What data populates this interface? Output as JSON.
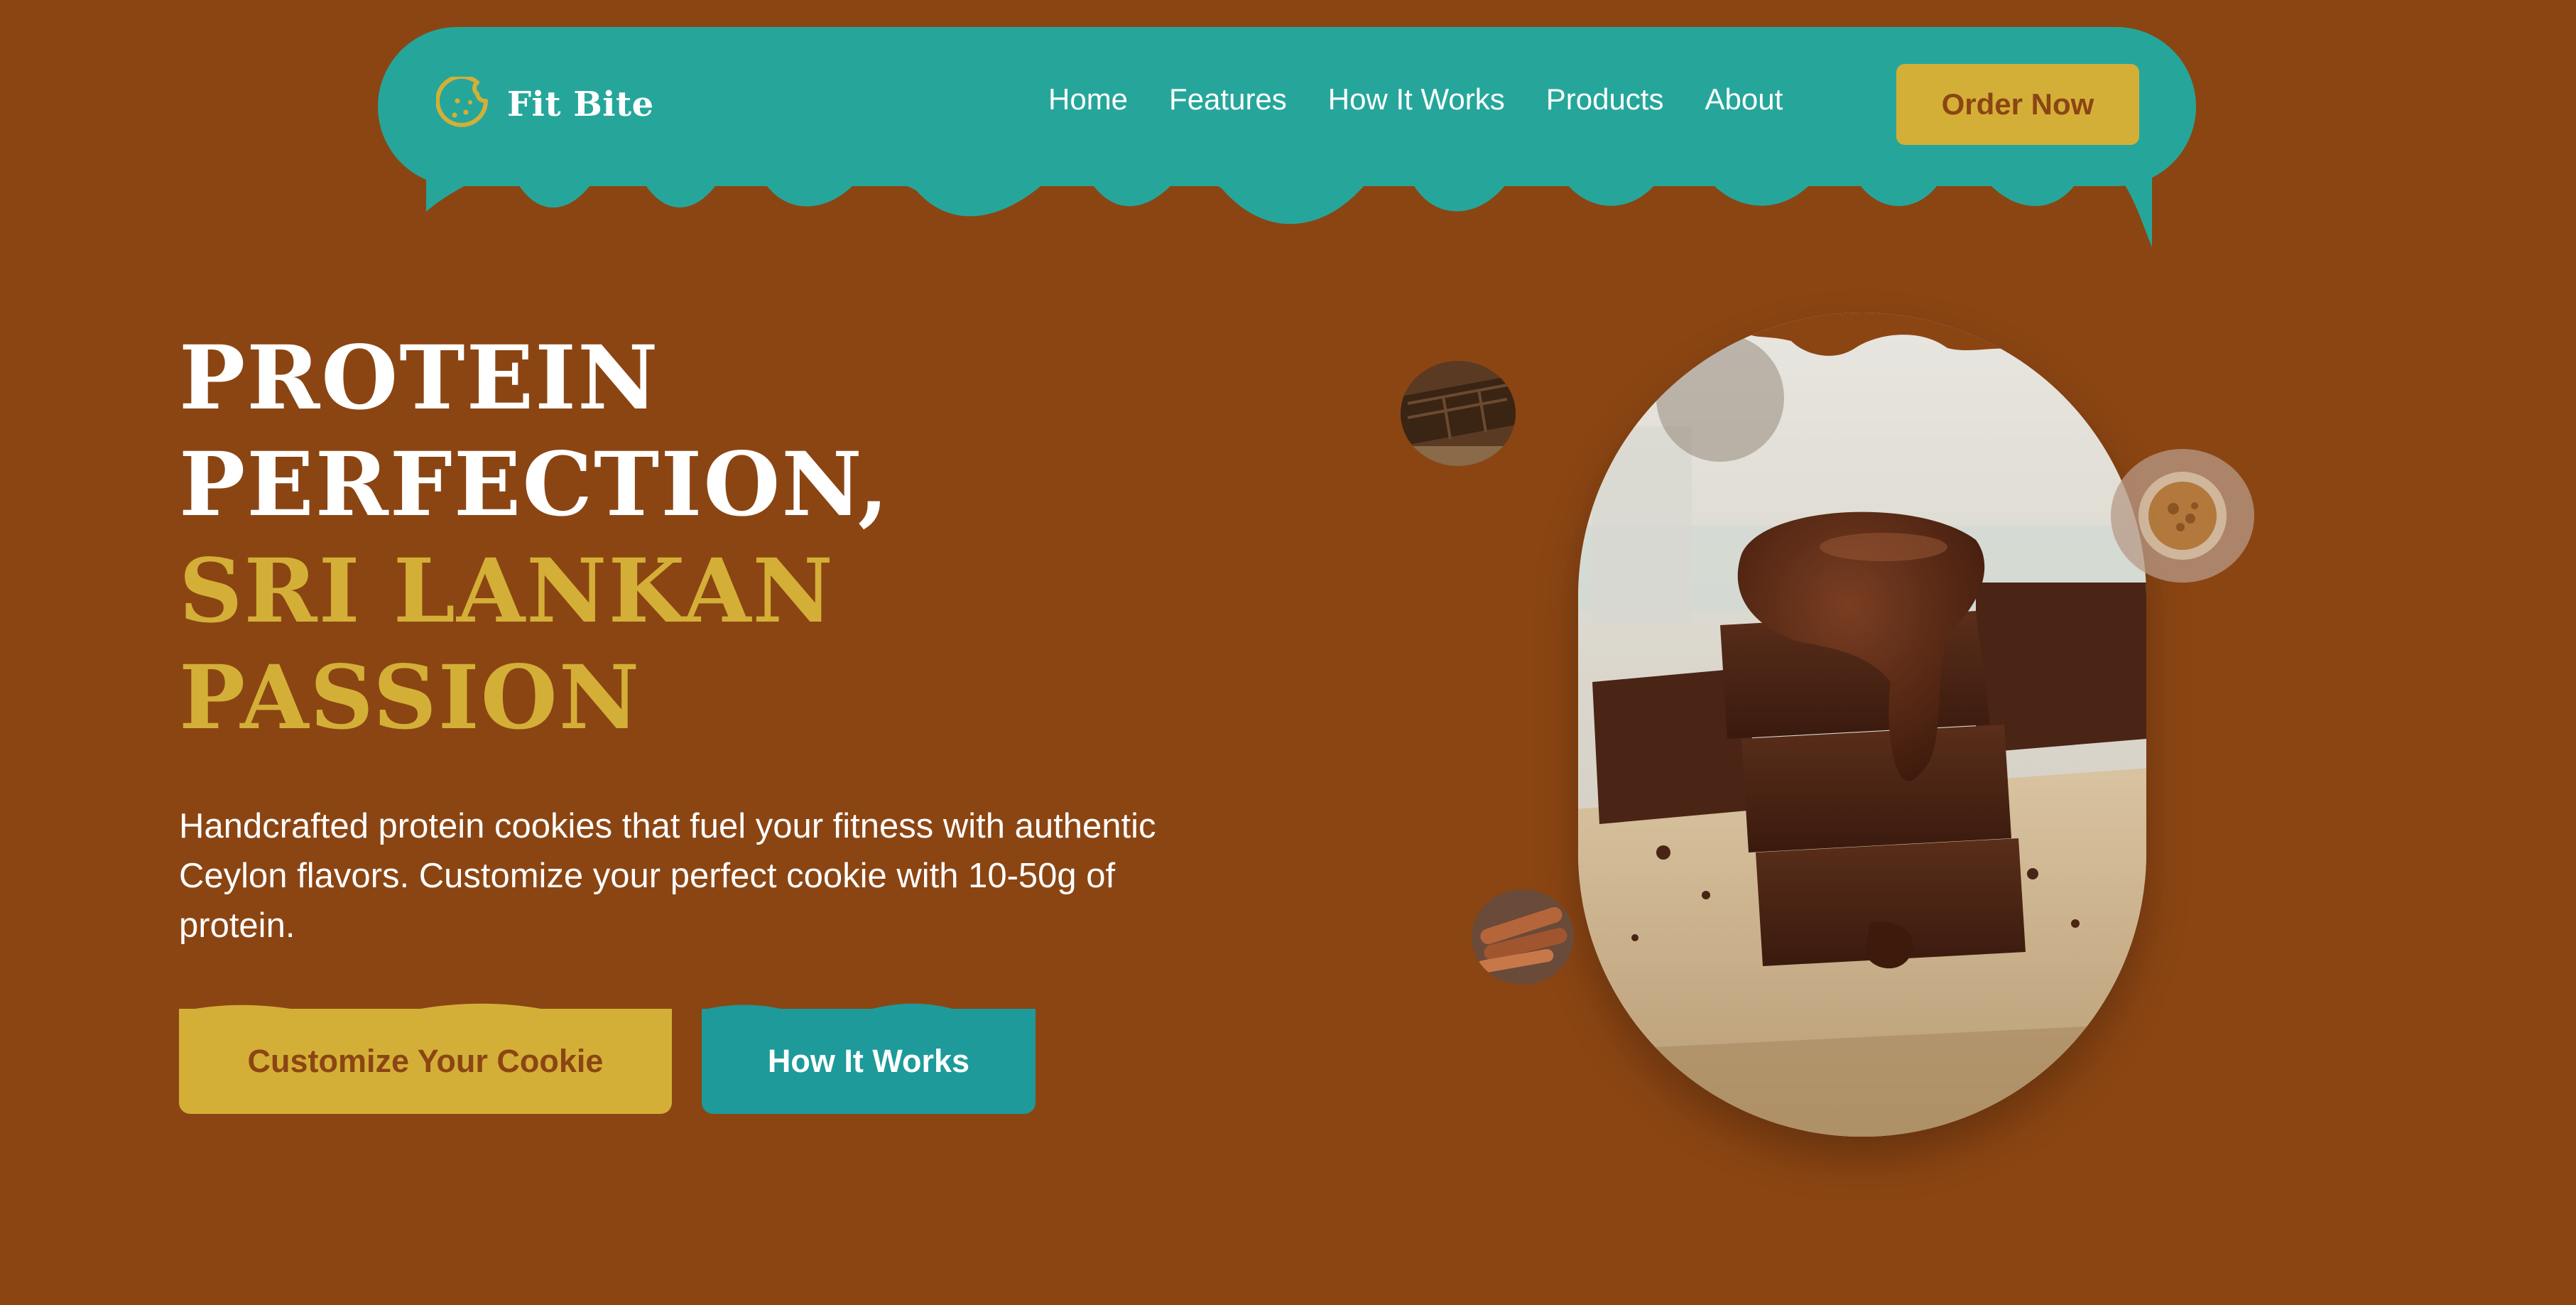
{
  "colors": {
    "background": "#8B4513",
    "navbar": "#26A69A",
    "gold": "#D4AF37",
    "teal_button": "#1E9A9A",
    "white": "#FFFFFF"
  },
  "navbar": {
    "logo_icon": "cookie-icon",
    "brand_name": "Fit Bite",
    "links": [
      {
        "label": "Home"
      },
      {
        "label": "Features"
      },
      {
        "label": "How It Works"
      },
      {
        "label": "Products"
      },
      {
        "label": "About"
      }
    ],
    "cta_label": "Order Now"
  },
  "hero": {
    "title_lines_white": [
      "PROTEIN",
      "PERFECTION,"
    ],
    "title_lines_gold": [
      "SRI LANKAN",
      "PASSION"
    ],
    "description": "Handcrafted protein cookies that fuel your fitness with authentic Ceylon flavors. Customize your perfect cookie with 10-50g of protein.",
    "primary_button": "Customize Your Cookie",
    "secondary_button": "How It Works"
  },
  "images": {
    "main": "chocolate-brownie-stack-image",
    "thumbnails": [
      "chocolate-bar-image",
      "nuts-bowl-image",
      "cinnamon-sticks-image"
    ]
  }
}
